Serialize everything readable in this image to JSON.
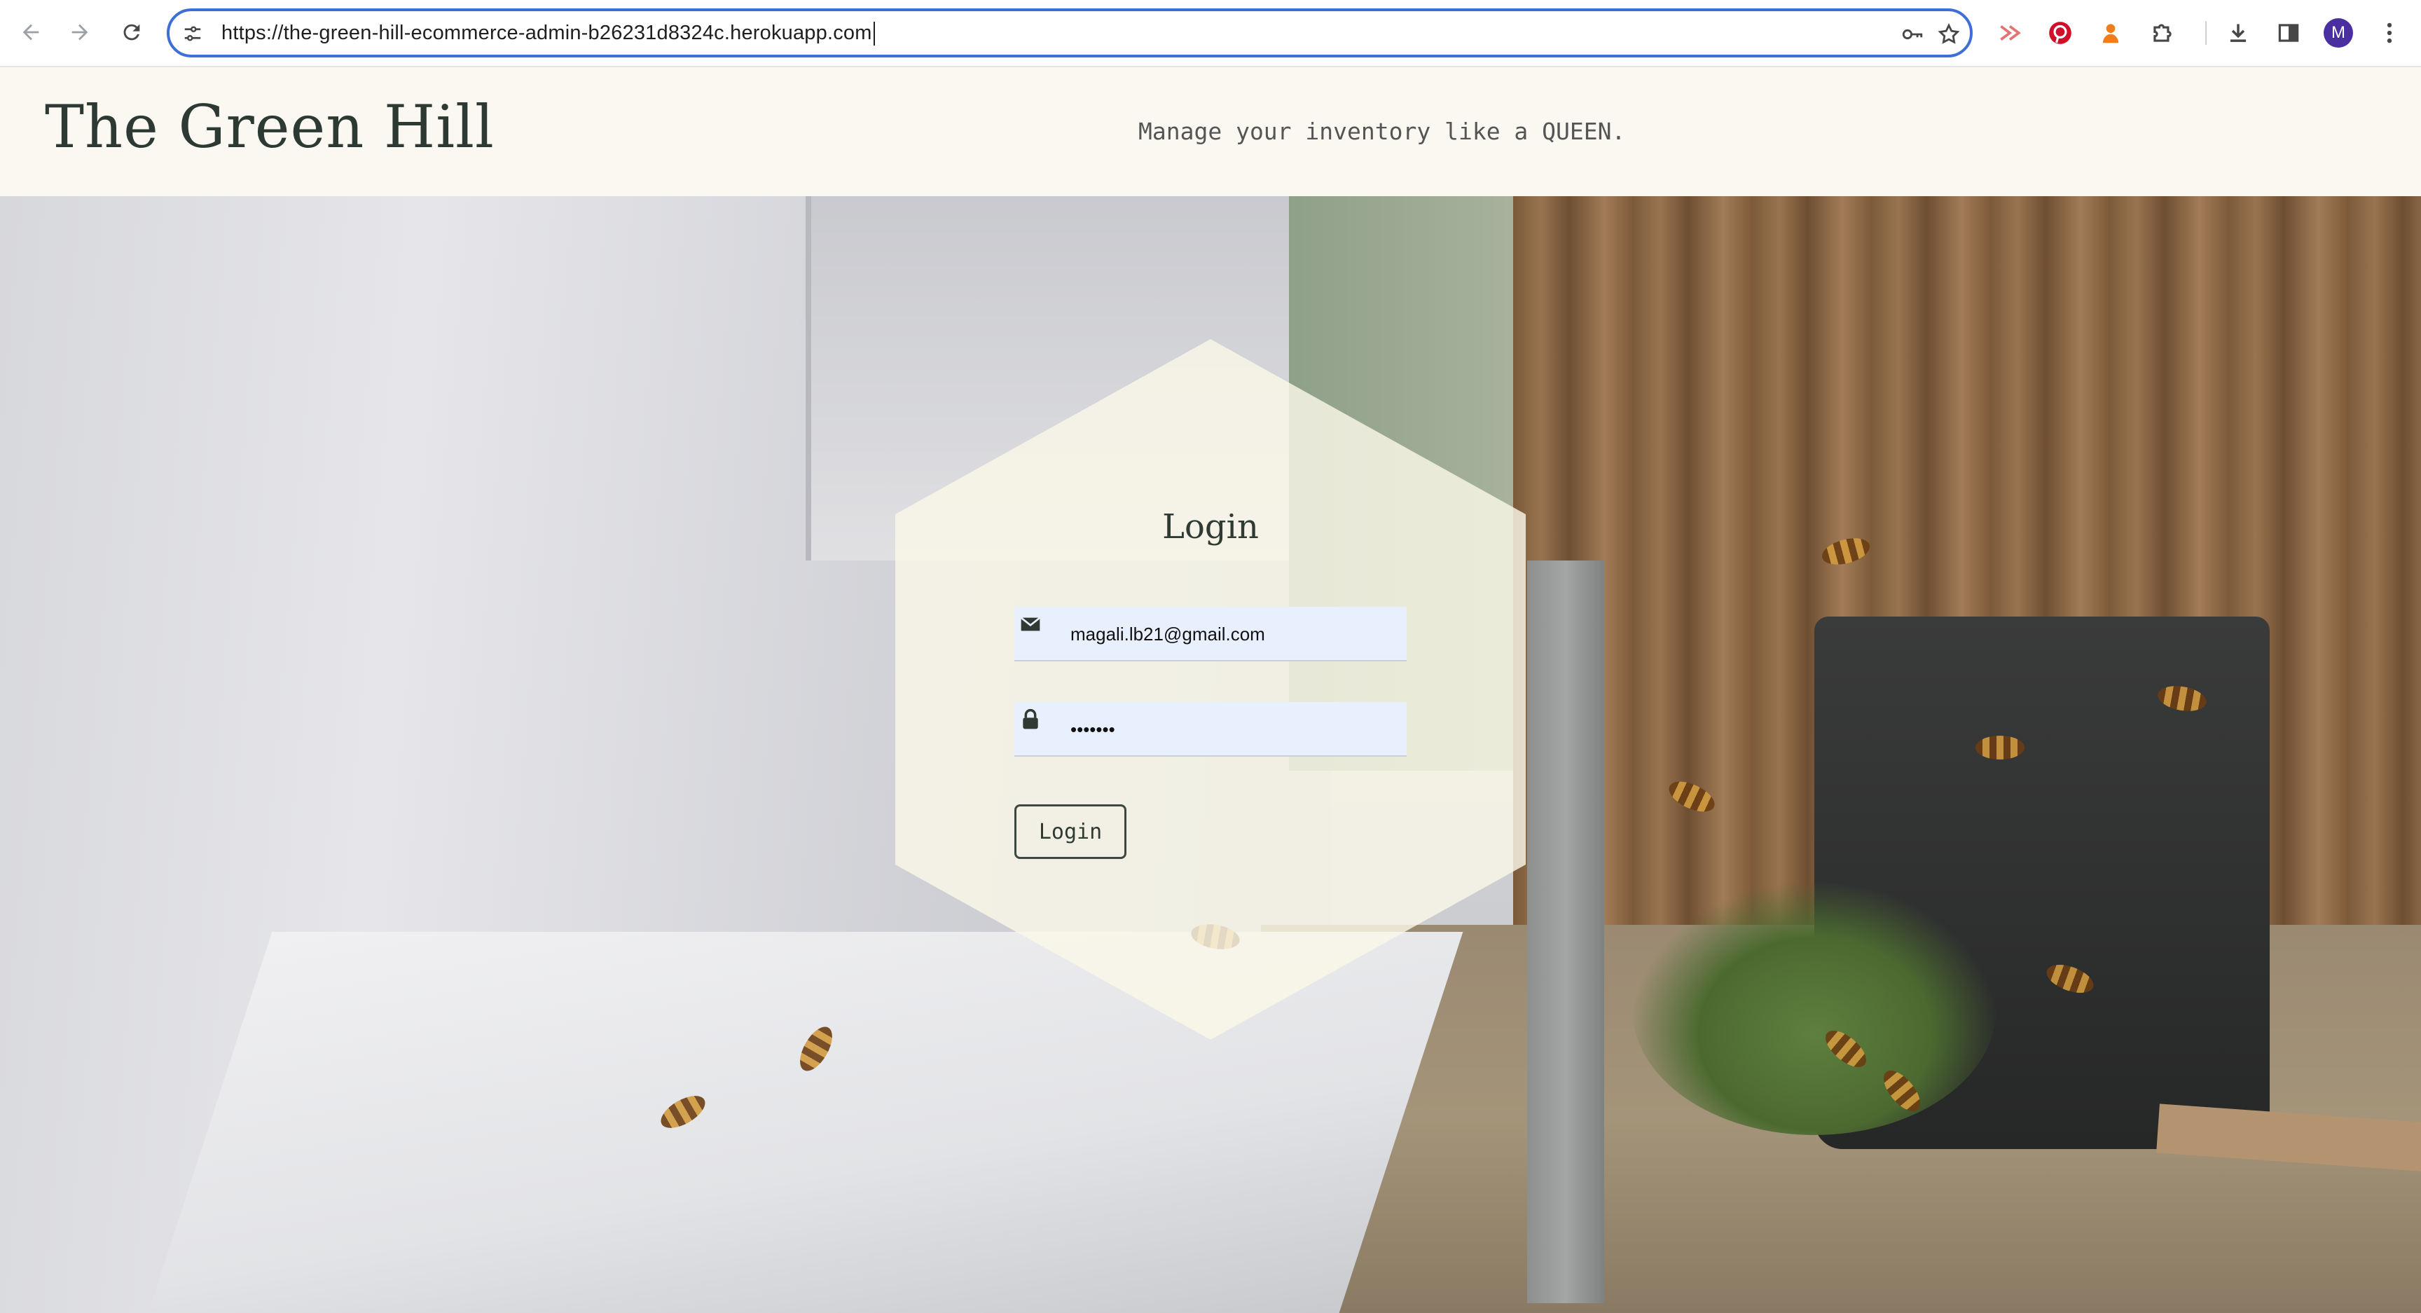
{
  "browser": {
    "url": "https://the-green-hill-ecommerce-admin-b26231d8324c.herokuapp.com",
    "back_icon": "arrow-left-icon",
    "forward_icon": "arrow-right-icon",
    "reload_icon": "reload-icon",
    "site_info_icon": "tune-icon",
    "password_icon": "key-icon",
    "bookmark_icon": "star-icon",
    "extensions": [
      "cast-extension-icon",
      "pinterest-icon",
      "honey-extension-icon",
      "puzzle-extensions-icon"
    ],
    "download_icon": "download-icon",
    "side_panel_icon": "side-panel-icon",
    "profile_initial": "M",
    "menu_icon": "kebab-menu-icon",
    "accent_color": "#3f6fd6"
  },
  "header": {
    "brand": "The Green Hill",
    "tagline": "Manage your inventory like a QUEEN."
  },
  "login": {
    "title": "Login",
    "email_value": "magali.lb21@gmail.com",
    "password_value": "•••••••",
    "submit_label": "Login",
    "email_icon": "envelope-icon",
    "password_icon": "lock-icon"
  }
}
